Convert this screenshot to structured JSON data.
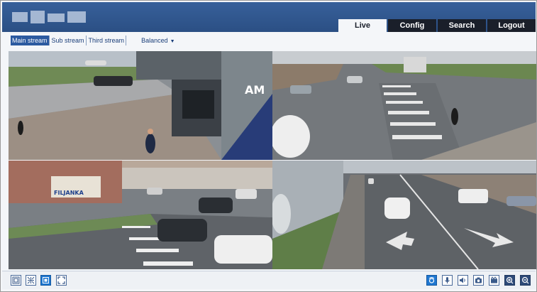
{
  "header": {
    "tabs": [
      {
        "label": "Live",
        "active": true
      },
      {
        "label": "Config",
        "active": false
      },
      {
        "label": "Search",
        "active": false
      },
      {
        "label": "Logout",
        "active": false
      }
    ]
  },
  "streams": {
    "items": [
      {
        "label": "Main stream",
        "active": true
      },
      {
        "label": "Sub stream",
        "active": false
      },
      {
        "label": "Third stream",
        "active": false
      }
    ],
    "quality": "Balanced"
  },
  "video": {
    "channels": [
      {
        "id": "channel-1",
        "overlay_text": "AM"
      },
      {
        "id": "channel-2"
      },
      {
        "id": "channel-3",
        "overlay_text": "FILJANKA"
      },
      {
        "id": "channel-4"
      }
    ]
  },
  "toolbar": {
    "left_icons": [
      "single-view-icon",
      "quad-view-icon",
      "original-size-icon",
      "fullscreen-icon"
    ],
    "right_icons": [
      "stream-active-icon",
      "microphone-icon",
      "speaker-icon",
      "snapshot-icon",
      "record-icon",
      "zoom-in-icon",
      "zoom-out-icon"
    ]
  },
  "colors": {
    "header": "#2b4f84",
    "tab_dark": "#1a1f2a",
    "accent": "#2c5aa0",
    "link": "#1b3f7a"
  }
}
